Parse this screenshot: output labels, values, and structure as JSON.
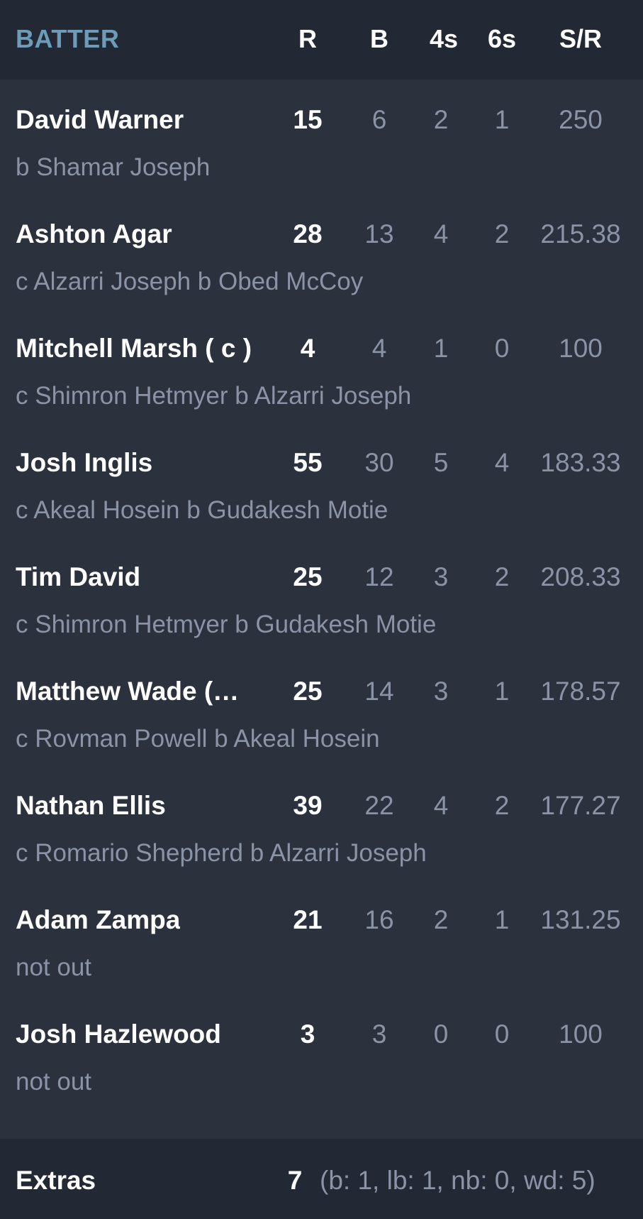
{
  "header": {
    "batter_label": "BATTER",
    "columns": [
      "R",
      "B",
      "4s",
      "6s",
      "S/R"
    ]
  },
  "batters": [
    {
      "name": "David Warner",
      "dismissal": "b Shamar Joseph",
      "runs": "15",
      "balls": "6",
      "fours": "2",
      "sixes": "1",
      "strike_rate": "250"
    },
    {
      "name": "Ashton Agar",
      "dismissal": "c Alzarri Joseph b Obed McCoy",
      "runs": "28",
      "balls": "13",
      "fours": "4",
      "sixes": "2",
      "strike_rate": "215.38"
    },
    {
      "name": "Mitchell Marsh ( c )",
      "dismissal": "c Shimron Hetmyer b Alzarri Joseph",
      "runs": "4",
      "balls": "4",
      "fours": "1",
      "sixes": "0",
      "strike_rate": "100"
    },
    {
      "name": "Josh Inglis",
      "dismissal": "c Akeal Hosein b Gudakesh Motie",
      "runs": "55",
      "balls": "30",
      "fours": "5",
      "sixes": "4",
      "strike_rate": "183.33"
    },
    {
      "name": "Tim David",
      "dismissal": "c Shimron Hetmyer b Gudakesh Motie",
      "runs": "25",
      "balls": "12",
      "fours": "3",
      "sixes": "2",
      "strike_rate": "208.33"
    },
    {
      "name": "Matthew Wade (…",
      "dismissal": "c Rovman Powell b Akeal Hosein",
      "runs": "25",
      "balls": "14",
      "fours": "3",
      "sixes": "1",
      "strike_rate": "178.57"
    },
    {
      "name": "Nathan Ellis",
      "dismissal": "c Romario Shepherd b Alzarri Joseph",
      "runs": "39",
      "balls": "22",
      "fours": "4",
      "sixes": "2",
      "strike_rate": "177.27"
    },
    {
      "name": "Adam Zampa",
      "dismissal": "not out",
      "runs": "21",
      "balls": "16",
      "fours": "2",
      "sixes": "1",
      "strike_rate": "131.25"
    },
    {
      "name": "Josh Hazlewood",
      "dismissal": "not out",
      "runs": "3",
      "balls": "3",
      "fours": "0",
      "sixes": "0",
      "strike_rate": "100"
    }
  ],
  "extras": {
    "label": "Extras",
    "total": "7",
    "detail": "(b: 1, lb: 1, nb: 0, wd: 5)"
  },
  "colors": {
    "background": "#2b313d",
    "header_background": "#222834",
    "accent": "#6e9bb8",
    "muted_text": "#8a94a6",
    "primary_text": "#ffffff"
  }
}
